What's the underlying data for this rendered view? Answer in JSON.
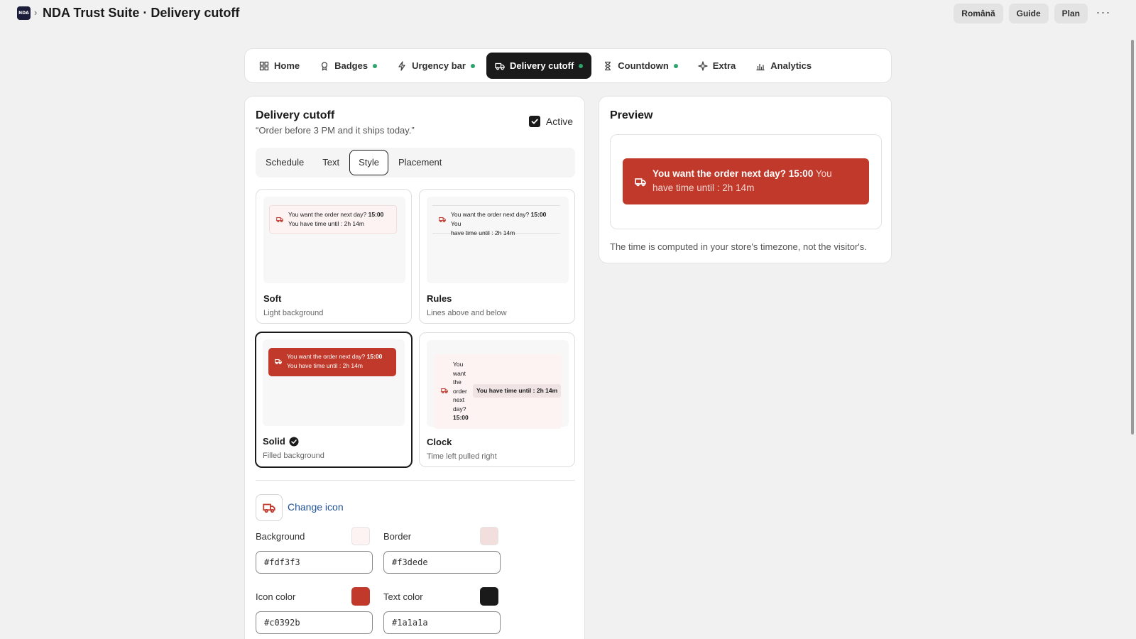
{
  "app": {
    "logo_text": "NDA",
    "crumb_sep": "›",
    "title": "NDA Trust Suite · Delivery cutoff"
  },
  "top_actions": {
    "language": "Română",
    "guide": "Guide",
    "plan": "Plan",
    "more": "···"
  },
  "nav": {
    "tabs": [
      {
        "label": "Home",
        "icon": "grid-icon",
        "dot": false
      },
      {
        "label": "Badges",
        "icon": "badge-icon",
        "dot": true
      },
      {
        "label": "Urgency bar",
        "icon": "bolt-icon",
        "dot": true
      },
      {
        "label": "Delivery cutoff",
        "icon": "truck-icon",
        "dot": true,
        "active": true
      },
      {
        "label": "Countdown",
        "icon": "hourglass-icon",
        "dot": true
      },
      {
        "label": "Extra",
        "icon": "sparkle-icon",
        "dot": false
      },
      {
        "label": "Analytics",
        "icon": "chart-icon",
        "dot": false
      }
    ],
    "dot_color": "#2ea36b"
  },
  "editor": {
    "title": "Delivery cutoff",
    "subtitle": "“Order before 3 PM and it ships today.”",
    "active_label": "Active",
    "active_checked": true,
    "subtabs": [
      "Schedule",
      "Text",
      "Style",
      "Placement"
    ],
    "subtab_selected": "Style",
    "styles": [
      {
        "name": "Soft",
        "desc": "Light background"
      },
      {
        "name": "Rules",
        "desc": "Lines above and below"
      },
      {
        "name": "Solid",
        "desc": "Filled background",
        "selected": true
      },
      {
        "name": "Clock",
        "desc": "Time left pulled right"
      }
    ],
    "sample": {
      "lead": "You want the order next day?",
      "time": "15:00",
      "tail": "You have time until : 2h 14m",
      "rules_tail_a": "You",
      "rules_tail_b": "have time until : 2h 14m",
      "clock_pill": "You have time until : 2h 14m"
    },
    "change_icon": "Change icon",
    "fields": {
      "background": {
        "label": "Background",
        "value": "#fdf3f3"
      },
      "border": {
        "label": "Border",
        "value": "#f3dede"
      },
      "icon_color": {
        "label": "Icon color",
        "value": "#c0392b"
      },
      "text_color": {
        "label": "Text color",
        "value": "#1a1a1a"
      }
    }
  },
  "preview": {
    "title": "Preview",
    "bar_lead": "You want the order next day?",
    "bar_time": "15:00",
    "bar_tail": "You have time until : 2h 14m",
    "note": "The time is computed in your store's timezone, not the visitor's.",
    "bar_color": "#c0392b"
  }
}
